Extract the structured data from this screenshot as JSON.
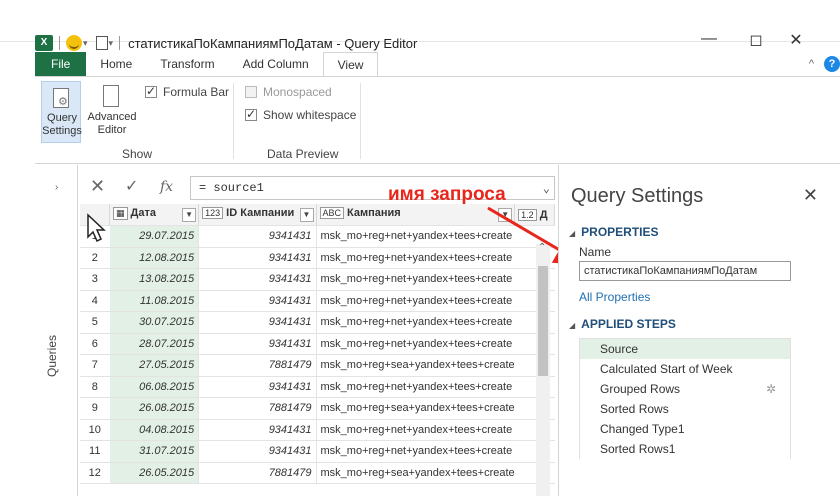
{
  "window": {
    "app_icon": "X",
    "title": "статистикаПоКампаниямПоДатам - Query Editor",
    "minimize": "—",
    "restore": "◻",
    "close": "✕"
  },
  "ribbon": {
    "tabs": [
      "File",
      "Home",
      "Transform",
      "Add Column",
      "View"
    ],
    "active_tab": "View",
    "query_settings_label": "Query Settings",
    "advanced_editor_label": "Advanced Editor",
    "formula_bar_label": "Formula Bar",
    "monospaced_label": "Monospaced",
    "show_whitespace_label": "Show whitespace",
    "group_show": "Show",
    "group_data_preview": "Data Preview"
  },
  "queries_pane": {
    "label": "Queries"
  },
  "formula_bar": {
    "formula": "= source1"
  },
  "annotation": {
    "text": "имя запроса",
    "color": "#e8261b"
  },
  "grid": {
    "columns": [
      {
        "type_icon": "▦",
        "name": "Дата"
      },
      {
        "type_icon": "123",
        "name": "ID Кампании"
      },
      {
        "type_icon": "ABC",
        "name": "Кампания"
      },
      {
        "type_icon": "1.2",
        "name": "Д"
      }
    ],
    "rows": [
      [
        "1",
        "29.07.2015",
        "9341431",
        "msk_mo+reg+net+yandex+tees+create"
      ],
      [
        "2",
        "12.08.2015",
        "9341431",
        "msk_mo+reg+net+yandex+tees+create"
      ],
      [
        "3",
        "13.08.2015",
        "9341431",
        "msk_mo+reg+net+yandex+tees+create"
      ],
      [
        "4",
        "11.08.2015",
        "9341431",
        "msk_mo+reg+net+yandex+tees+create"
      ],
      [
        "5",
        "30.07.2015",
        "9341431",
        "msk_mo+reg+net+yandex+tees+create"
      ],
      [
        "6",
        "28.07.2015",
        "9341431",
        "msk_mo+reg+net+yandex+tees+create"
      ],
      [
        "7",
        "27.05.2015",
        "7881479",
        "msk_mo+reg+sea+yandex+tees+create"
      ],
      [
        "8",
        "06.08.2015",
        "9341431",
        "msk_mo+reg+net+yandex+tees+create"
      ],
      [
        "9",
        "26.08.2015",
        "7881479",
        "msk_mo+reg+sea+yandex+tees+create"
      ],
      [
        "10",
        "04.08.2015",
        "9341431",
        "msk_mo+reg+net+yandex+tees+create"
      ],
      [
        "11",
        "31.07.2015",
        "9341431",
        "msk_mo+reg+net+yandex+tees+create"
      ],
      [
        "12",
        "26.05.2015",
        "7881479",
        "msk_mo+reg+sea+yandex+tees+create"
      ]
    ]
  },
  "query_settings": {
    "title": "Query Settings",
    "close": "✕",
    "properties_heading": "PROPERTIES",
    "name_label": "Name",
    "name_value": "статистикаПоКампаниямПоДатам",
    "all_properties": "All Properties",
    "applied_steps_heading": "APPLIED STEPS",
    "steps": [
      "Source",
      "Calculated Start of Week",
      "Grouped Rows",
      "Sorted Rows",
      "Changed Type1",
      "Sorted Rows1"
    ],
    "selected_step": "Source"
  }
}
